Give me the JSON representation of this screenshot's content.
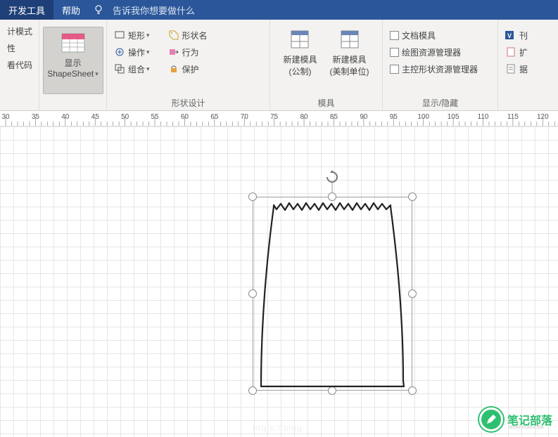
{
  "tabs": {
    "dev": "开发工具",
    "help": "帮助",
    "tellme": "告诉我你想要做什么"
  },
  "group1": {
    "itemA": "计模式",
    "itemB": "性",
    "itemC": "看代码"
  },
  "shapesheet": {
    "line1": "显示",
    "line2": "ShapeSheet"
  },
  "shapeDesign": {
    "rect": "矩形",
    "ops": "操作",
    "combine": "组合",
    "shapeName": "形状名",
    "behavior": "行为",
    "protect": "保护",
    "label": "形状设计"
  },
  "stencil": {
    "newMetric": "新建模具",
    "newMetricSub": "(公制)",
    "newUS": "新建模具",
    "newUSSub": "(美制单位)",
    "label": "模具"
  },
  "showHide": {
    "docStencil": "文档模具",
    "drawingExplorer": "绘图资源管理器",
    "masterExplorer": "主控形状资源管理器",
    "label": "显示/隐藏"
  },
  "ruler": {
    "marks": [
      30,
      35,
      40,
      45,
      50,
      55,
      60,
      65,
      70,
      75,
      80,
      85,
      90,
      95,
      100,
      105,
      110,
      115,
      120
    ]
  },
  "watermark": {
    "text": "笔记部落",
    "sub": "www.notetribe"
  },
  "blog": "https://blog."
}
